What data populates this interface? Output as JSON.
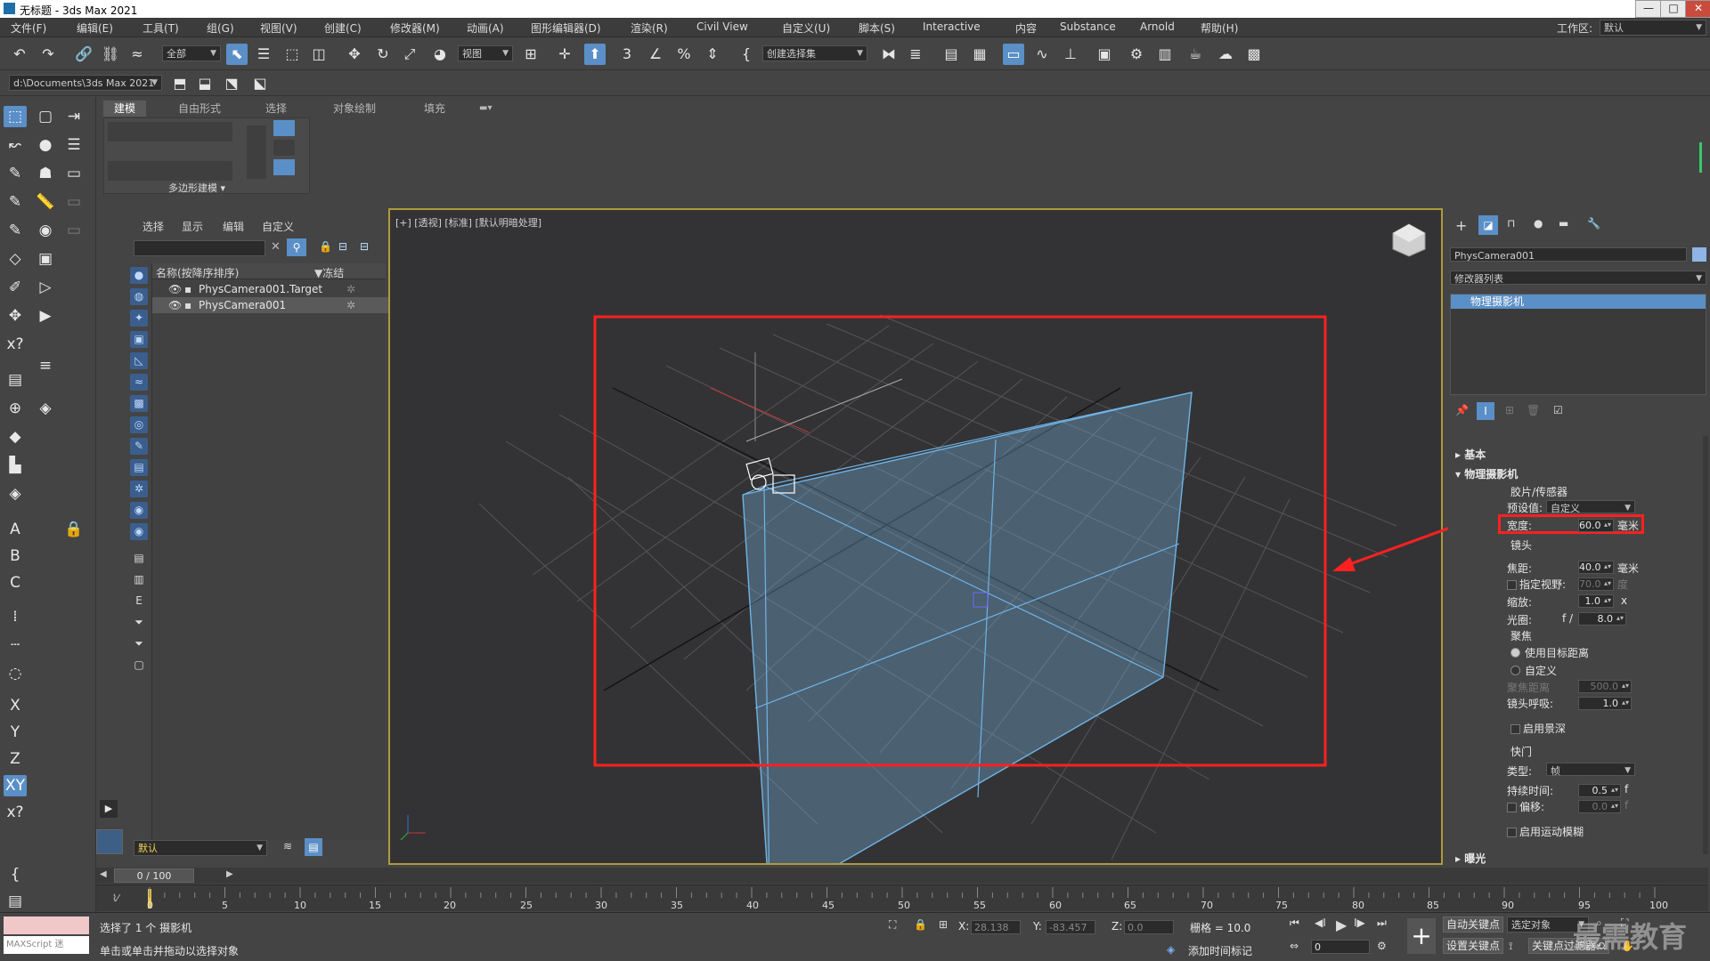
{
  "titlebar": {
    "title": "无标题 - 3ds Max 2021",
    "min": "—",
    "max": "□",
    "close": "✕"
  },
  "menubar": {
    "items": [
      "文件(F)",
      "编辑(E)",
      "工具(T)",
      "组(G)",
      "视图(V)",
      "创建(C)",
      "修改器(M)",
      "动画(A)",
      "图形编辑器(D)",
      "渲染(R)",
      "Civil View",
      "自定义(U)",
      "脚本(S)",
      "Interactive",
      "内容",
      "Substance",
      "Arnold",
      "帮助(H)"
    ],
    "workspace_label": "工作区:",
    "workspace_value": "默认"
  },
  "toolbar1": {
    "selection_filter": "全部",
    "ref_coord": "视图",
    "named_selection": "创建选择集"
  },
  "toolbar2": {
    "project_path": "d:\\Documents\\3ds Max 2021"
  },
  "ribbon": {
    "tabs": [
      "建模",
      "自由形式",
      "选择",
      "对象绘制",
      "填充"
    ],
    "active_tab": "建模",
    "panel_label": "多边形建模"
  },
  "scene_explorer": {
    "tabs": [
      "选择",
      "显示",
      "编辑",
      "自定义"
    ],
    "col_name": "名称(按降序排序)",
    "col_frozen": "▼冻结",
    "rows": [
      {
        "name": "PhysCamera001.Target",
        "selected": false
      },
      {
        "name": "PhysCamera001",
        "selected": true
      }
    ],
    "layer": "默认"
  },
  "viewport": {
    "label": "[+] [透视] [标准] [默认明暗处理]"
  },
  "command_panel": {
    "object_name": "PhysCamera001",
    "modifier_list": "修改器列表",
    "stack_item": "物理摄影机",
    "rollout_basic": "基本",
    "rollout_physcam": "物理摄影机",
    "film_group": "胶片/传感器",
    "preset_label": "预设值:",
    "preset_value": "自定义",
    "width_label": "宽度:",
    "width_value": "60.0",
    "unit_mm": "毫米",
    "lens_group": "镜头",
    "focal_label": "焦距:",
    "focal_value": "40.0",
    "fov_label": "指定视野:",
    "fov_value": "70.0",
    "fov_unit": "度",
    "zoom_label": "缩放:",
    "zoom_value": "1.0",
    "zoom_unit": "x",
    "aperture_label": "光圈:",
    "aperture_f": "f /",
    "aperture_value": "8.0",
    "focus_group": "聚焦",
    "focus_target": "使用目标距离",
    "focus_custom": "自定义",
    "focus_dist_label": "聚焦距离",
    "focus_dist_value": "500.0",
    "breathing_label": "镜头呼吸:",
    "breathing_value": "1.0",
    "dof_label": "启用景深",
    "shutter_group": "快门",
    "type_label": "类型:",
    "type_value": "帧",
    "duration_label": "持续时间:",
    "duration_value": "0.5",
    "duration_unit": "f",
    "offset_label": "偏移:",
    "offset_value": "0.0",
    "offset_unit": "f",
    "motion_blur_label": "启用运动模糊",
    "next_rollout": "曝光"
  },
  "timeline": {
    "frame_display": "0 / 100",
    "ticks": [
      "0",
      "5",
      "10",
      "15",
      "20",
      "25",
      "30",
      "35",
      "40",
      "45",
      "50",
      "55",
      "60",
      "65",
      "70",
      "75",
      "80",
      "85",
      "90",
      "95",
      "100"
    ]
  },
  "status": {
    "maxscript": "MAXScript 迷",
    "line1": "选择了 1 个 摄影机",
    "line2": "单击或单击并拖动以选择对象",
    "x_label": "X:",
    "x_value": "28.138",
    "y_label": "Y:",
    "y_value": "-83.457",
    "z_label": "Z:",
    "z_value": "0.0",
    "grid": "栅格 = 10.0",
    "add_time_tag": "添加时间标记",
    "auto_key": "自动关键点",
    "set_key": "设置关键点",
    "selected_obj": "选定对象",
    "key_filter": "关键点过滤器...",
    "frame_value": "0"
  },
  "watermark": "最需教育",
  "colors": {
    "viewport_border": "#b09a3c",
    "highlight_red": "#ff2020",
    "frustum": "#6fb4e6"
  }
}
